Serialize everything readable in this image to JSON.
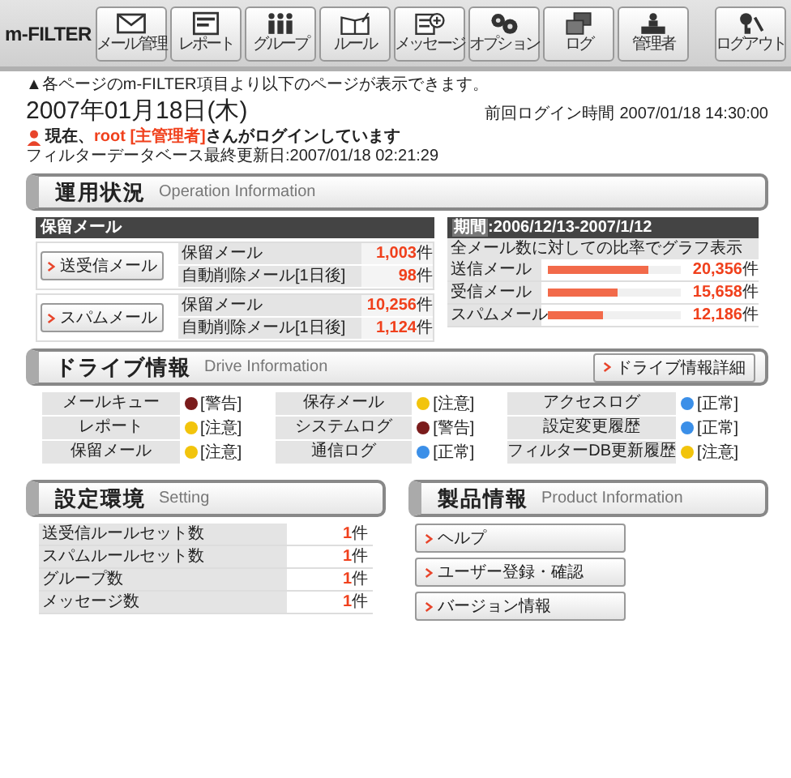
{
  "nav": {
    "logo": "m-FILTER",
    "buttons": [
      "メール管理",
      "レポート",
      "グループ",
      "ルール",
      "メッセージ",
      "オプション",
      "ログ",
      "管理者"
    ],
    "logout": "ログアウト"
  },
  "notice": "▲各ページのm-FILTER項目より以下のページが表示できます。",
  "date": "2007年01月18日(木)",
  "last_login": {
    "label": "前回ログイン時間",
    "value": "2007/01/18 14:30:00"
  },
  "login_status": {
    "prefix": "現在、",
    "user": "root [主管理者]",
    "suffix": "さんがログインしています"
  },
  "db_updated": "フィルターデータベース最終更新日:2007/01/18 02:21:29",
  "operation": {
    "title": "運用状況",
    "subtitle": "Operation Information",
    "held": {
      "header": "保留メール",
      "groups": [
        {
          "button": "送受信メール",
          "rows": [
            {
              "label": "保留メール",
              "value": "1,003",
              "unit": "件"
            },
            {
              "label": "自動削除メール[1日後]",
              "value": "98",
              "unit": "件"
            }
          ]
        },
        {
          "button": "スパムメール",
          "rows": [
            {
              "label": "保留メール",
              "value": "10,256",
              "unit": "件"
            },
            {
              "label": "自動削除メール[1日後]",
              "value": "1,124",
              "unit": "件"
            }
          ]
        }
      ]
    },
    "period": {
      "label": "期間",
      "range": ":2006/12/13-2007/1/12",
      "note": "全メール数に対しての比率でグラフ表示",
      "rows": [
        {
          "label": "送信メール",
          "level": 0.76,
          "value": "20,356",
          "unit": "件"
        },
        {
          "label": "受信メール",
          "level": 0.53,
          "value": "15,658",
          "unit": "件"
        },
        {
          "label": "スパムメール",
          "level": 0.42,
          "value": "12,186",
          "unit": "件"
        }
      ]
    }
  },
  "drive": {
    "title": "ドライブ情報",
    "subtitle": "Drive Information",
    "button": "ドライブ情報詳細",
    "items": [
      {
        "label": "メールキュー",
        "status": "[警告]",
        "color": "#7a1c1c"
      },
      {
        "label": "保存メール",
        "status": "[注意]",
        "color": "#f2c40c"
      },
      {
        "label": "アクセスログ",
        "status": "[正常]",
        "color": "#3b8fe8"
      },
      {
        "label": "レポート",
        "status": "[注意]",
        "color": "#f2c40c"
      },
      {
        "label": "システムログ",
        "status": "[警告]",
        "color": "#7a1c1c"
      },
      {
        "label": "設定変更履歴",
        "status": "[正常]",
        "color": "#3b8fe8"
      },
      {
        "label": "保留メール",
        "status": "[注意]",
        "color": "#f2c40c"
      },
      {
        "label": "通信ログ",
        "status": "[正常]",
        "color": "#3b8fe8"
      },
      {
        "label": "フィルターDB更新履歴",
        "status": "[注意]",
        "color": "#f2c40c"
      }
    ]
  },
  "setting": {
    "title": "設定環境",
    "subtitle": "Setting",
    "rows": [
      {
        "label": "送受信ルールセット数",
        "value": "1",
        "unit": "件"
      },
      {
        "label": "スパムルールセット数",
        "value": "1",
        "unit": "件"
      },
      {
        "label": "グループ数",
        "value": "1",
        "unit": "件"
      },
      {
        "label": "メッセージ数",
        "value": "1",
        "unit": "件"
      }
    ]
  },
  "product": {
    "title": "製品情報",
    "subtitle": "Product Information",
    "links": [
      "ヘルプ",
      "ユーザー登録・確認",
      "バージョン情報"
    ]
  }
}
